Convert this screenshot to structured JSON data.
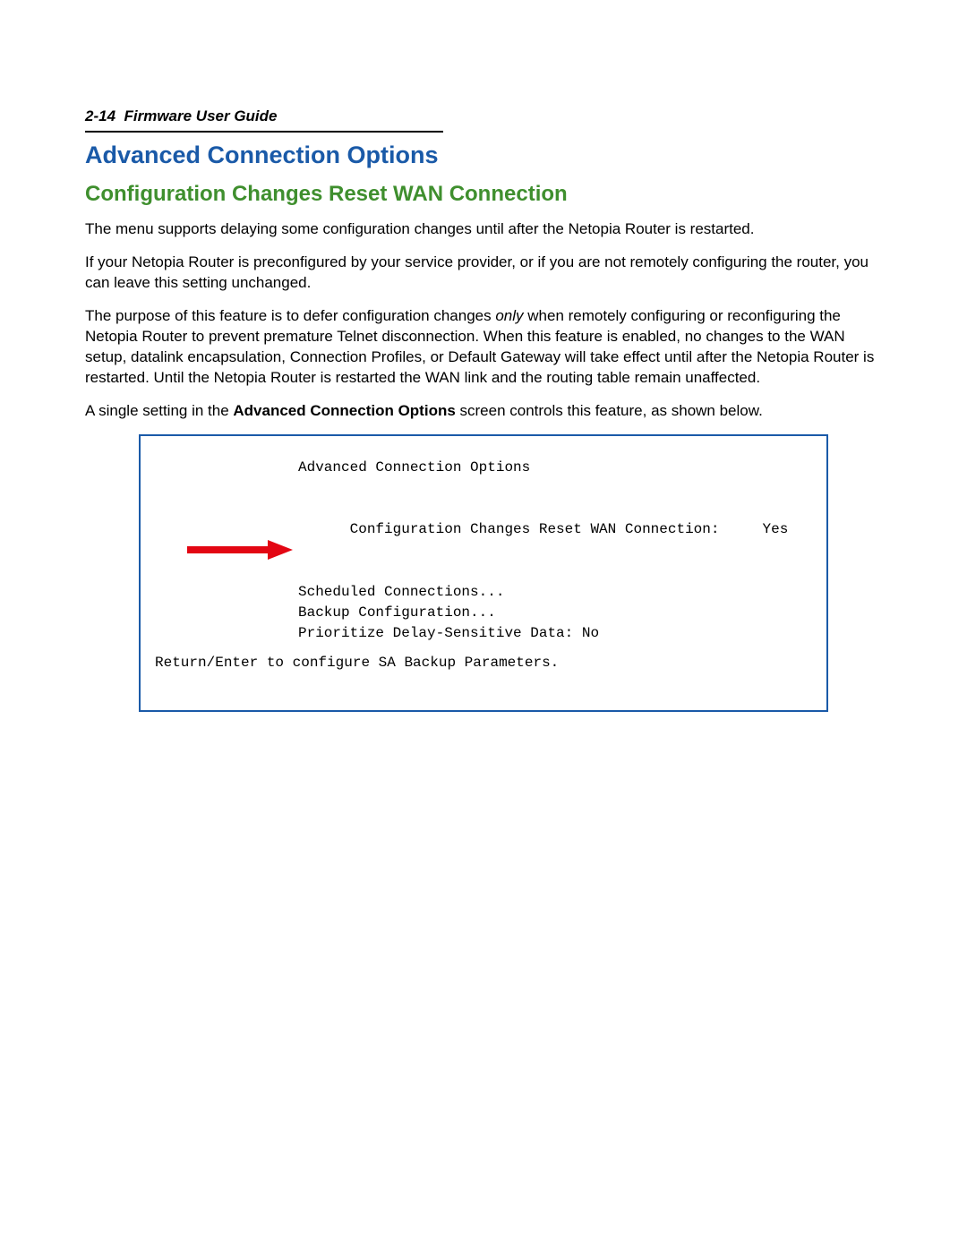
{
  "header": {
    "page_ref": "2-14",
    "doc_title": "Firmware User Guide"
  },
  "headings": {
    "h1": "Advanced Connection Options",
    "h2": "Configuration Changes Reset WAN Connection"
  },
  "paragraphs": {
    "p1": "The menu supports delaying some configuration changes until after the Netopia Router is restarted.",
    "p2": "If your Netopia Router is preconfigured by your service provider, or if you are not remotely configuring the router, you can leave this setting unchanged.",
    "p3_a": "The purpose of this feature is to defer configuration changes ",
    "p3_only": "only",
    "p3_b": " when remotely configuring or reconfiguring the Netopia Router to prevent premature Telnet disconnection. When this feature is enabled, no changes to the WAN setup, datalink encapsulation, Connection Profiles, or Default Gateway will take effect until after the Netopia Router is restarted. Until the Netopia Router is restarted the WAN link and the routing table remain unaffected.",
    "p4_a": "A single setting in the ",
    "p4_bold": "Advanced Connection Options",
    "p4_b": " screen controls this feature, as shown below."
  },
  "terminal": {
    "title": "Advanced Connection Options",
    "config_label": "Configuration Changes Reset WAN Connection:",
    "config_value": "Yes",
    "scheduled": "Scheduled Connections...",
    "backup": "Backup Configuration...",
    "prioritize_label": "Prioritize Delay-Sensitive Data:",
    "prioritize_value": "No",
    "footer": "Return/Enter to configure SA Backup Parameters."
  }
}
